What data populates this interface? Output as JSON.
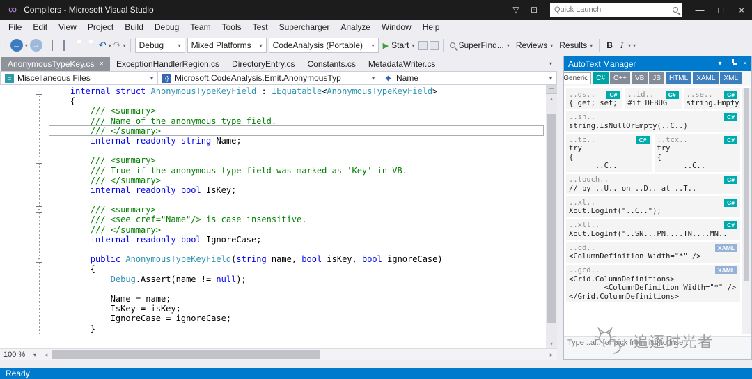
{
  "window": {
    "title": "Compilers - Microsoft Visual Studio"
  },
  "quick_launch": {
    "placeholder": "Quick Launch"
  },
  "icons": {
    "logo": "∞",
    "filter": "▽",
    "feedback": "⊡",
    "minimize": "—",
    "maximize": "□",
    "close": "×",
    "back": "←",
    "forward": "→",
    "undo": "↶",
    "redo": "↷",
    "caret": "▾",
    "play": "▶",
    "fold": "-",
    "split": "—",
    "scroll_up": "▴",
    "scroll_down": "▾",
    "scroll_left": "◂",
    "scroll_right": "▸"
  },
  "menu": {
    "items": [
      "File",
      "Edit",
      "View",
      "Project",
      "Build",
      "Debug",
      "Team",
      "Tools",
      "Test",
      "Supercharger",
      "Analyze",
      "Window",
      "Help"
    ]
  },
  "toolbar": {
    "solution_config": "Debug",
    "platform": "Mixed Platforms",
    "run_config": "CodeAnalysis (Portable)",
    "start": "Start",
    "superfind": "SuperFind...",
    "reviews": "Reviews",
    "results": "Results",
    "bold": "B",
    "italic": "I"
  },
  "doc_tabs": [
    {
      "label": "AnonymousTypeKey.cs",
      "active": true
    },
    {
      "label": "ExceptionHandlerRegion.cs",
      "active": false
    },
    {
      "label": "DirectoryEntry.cs",
      "active": false
    },
    {
      "label": "Constants.cs",
      "active": false
    },
    {
      "label": "MetadataWriter.cs",
      "active": false
    }
  ],
  "breadcrumb": {
    "project": "Miscellaneous Files",
    "type": "Microsoft.CodeAnalysis.Emit.AnonymousTyp",
    "member": "Name"
  },
  "editor": {
    "zoom": "100 %",
    "lines": [
      {
        "fold": true,
        "tokens": [
          [
            "p",
            "    "
          ],
          [
            "k",
            "internal"
          ],
          [
            "p",
            " "
          ],
          [
            "k",
            "struct"
          ],
          [
            "p",
            " "
          ],
          [
            "t",
            "AnonymousTypeKeyField"
          ],
          [
            "p",
            " : "
          ],
          [
            "t",
            "IEquatable"
          ],
          [
            "p",
            "<"
          ],
          [
            "t",
            "AnonymousTypeKeyField"
          ],
          [
            "p",
            ">"
          ]
        ]
      },
      {
        "tokens": [
          [
            "p",
            "    {"
          ]
        ]
      },
      {
        "tokens": [
          [
            "p",
            "        "
          ],
          [
            "c",
            "/// <summary>"
          ]
        ]
      },
      {
        "tokens": [
          [
            "p",
            "        "
          ],
          [
            "c",
            "/// Name of the anonymous type field."
          ]
        ]
      },
      {
        "hl": true,
        "tokens": [
          [
            "p",
            "        "
          ],
          [
            "c",
            "/// </summary>"
          ]
        ]
      },
      {
        "tokens": [
          [
            "p",
            "        "
          ],
          [
            "k",
            "internal"
          ],
          [
            "p",
            " "
          ],
          [
            "k",
            "readonly"
          ],
          [
            "p",
            " "
          ],
          [
            "k",
            "string"
          ],
          [
            "p",
            " Name;"
          ]
        ]
      },
      {
        "tokens": []
      },
      {
        "fold": true,
        "tokens": [
          [
            "p",
            "        "
          ],
          [
            "c",
            "/// <summary>"
          ]
        ]
      },
      {
        "tokens": [
          [
            "p",
            "        "
          ],
          [
            "c",
            "/// True if the anonymous type field was marked as 'Key' in VB."
          ]
        ]
      },
      {
        "tokens": [
          [
            "p",
            "        "
          ],
          [
            "c",
            "/// </summary>"
          ]
        ]
      },
      {
        "tokens": [
          [
            "p",
            "        "
          ],
          [
            "k",
            "internal"
          ],
          [
            "p",
            " "
          ],
          [
            "k",
            "readonly"
          ],
          [
            "p",
            " "
          ],
          [
            "k",
            "bool"
          ],
          [
            "p",
            " IsKey;"
          ]
        ]
      },
      {
        "tokens": []
      },
      {
        "fold": true,
        "tokens": [
          [
            "p",
            "        "
          ],
          [
            "c",
            "/// <summary>"
          ]
        ]
      },
      {
        "tokens": [
          [
            "p",
            "        "
          ],
          [
            "c",
            "/// <see cref=\"Name\"/> is case insensitive."
          ]
        ]
      },
      {
        "tokens": [
          [
            "p",
            "        "
          ],
          [
            "c",
            "/// </summary>"
          ]
        ]
      },
      {
        "tokens": [
          [
            "p",
            "        "
          ],
          [
            "k",
            "internal"
          ],
          [
            "p",
            " "
          ],
          [
            "k",
            "readonly"
          ],
          [
            "p",
            " "
          ],
          [
            "k",
            "bool"
          ],
          [
            "p",
            " IgnoreCase;"
          ]
        ]
      },
      {
        "tokens": []
      },
      {
        "fold": true,
        "tokens": [
          [
            "p",
            "        "
          ],
          [
            "k",
            "public"
          ],
          [
            "p",
            " "
          ],
          [
            "t",
            "AnonymousTypeKeyField"
          ],
          [
            "p",
            "("
          ],
          [
            "k",
            "string"
          ],
          [
            "p",
            " name, "
          ],
          [
            "k",
            "bool"
          ],
          [
            "p",
            " isKey, "
          ],
          [
            "k",
            "bool"
          ],
          [
            "p",
            " ignoreCase)"
          ]
        ]
      },
      {
        "tokens": [
          [
            "p",
            "        {"
          ]
        ]
      },
      {
        "tokens": [
          [
            "p",
            "            "
          ],
          [
            "t",
            "Debug"
          ],
          [
            "p",
            ".Assert(name != "
          ],
          [
            "k",
            "null"
          ],
          [
            "p",
            ");"
          ]
        ]
      },
      {
        "tokens": []
      },
      {
        "tokens": [
          [
            "p",
            "            Name = name;"
          ]
        ]
      },
      {
        "tokens": [
          [
            "p",
            "            IsKey = isKey;"
          ]
        ]
      },
      {
        "tokens": [
          [
            "p",
            "            IgnoreCase = ignoreCase;"
          ]
        ]
      },
      {
        "tokens": [
          [
            "p",
            "        }"
          ]
        ]
      }
    ]
  },
  "panel": {
    "title": "AutoText Manager",
    "lang_tabs": [
      {
        "label": "Generic",
        "style": "plain"
      },
      {
        "label": "C#",
        "style": "teal"
      },
      {
        "label": "C++",
        "style": "gray"
      },
      {
        "label": "VB",
        "style": "gray"
      },
      {
        "label": "JS",
        "style": "gray"
      },
      {
        "label": "HTML",
        "style": "blue"
      },
      {
        "label": "XAML",
        "style": "blue"
      },
      {
        "label": "XML",
        "style": "blue"
      }
    ],
    "rows": [
      [
        {
          "name": "..gs..",
          "lang": "C#",
          "body": [
            "{ get; set; }"
          ]
        },
        {
          "name": "..id..",
          "lang": "C#",
          "body": [
            "#if DEBUG"
          ]
        },
        {
          "name": "..se..",
          "lang": "C#",
          "body": [
            "string.Empty"
          ]
        }
      ],
      [
        {
          "name": "..sn..",
          "lang": "C#",
          "body": [
            "string.IsNullOrEmpty(..C..)"
          ]
        }
      ],
      [
        {
          "name": "..tc..",
          "lang": "C#",
          "body": [
            "try",
            "{",
            "      ..C.."
          ]
        },
        {
          "name": "..tcx..",
          "lang": "C#",
          "body": [
            "try",
            "{",
            "      ..C.."
          ]
        }
      ],
      [
        {
          "name": "..touch..",
          "lang": "C#",
          "body": [
            "// by ..U.. on ..D.. at ..T.."
          ]
        }
      ],
      [
        {
          "name": "..xl..",
          "lang": "C#",
          "body": [
            "Xout.LogInf(\"..C..\");"
          ]
        }
      ],
      [
        {
          "name": "..xll..",
          "lang": "C#",
          "body": [
            "Xout.LogInf(\"..SN...PN....TN....MN.."
          ]
        }
      ],
      [
        {
          "name": "..cd..",
          "lang": "XAML",
          "body": [
            "<ColumnDefinition Width=\"*\" />"
          ]
        }
      ],
      [
        {
          "name": "..gcd..",
          "lang": "XAML",
          "body": [
            "<Grid.ColumnDefinitions>",
            "        <ColumnDefinition Width=\"*\" />",
            "</Grid.ColumnDefinitions>"
          ]
        }
      ]
    ],
    "hint": "Type ..al.. [or pick from list] to insert"
  },
  "status": {
    "text": "Ready"
  },
  "watermark": {
    "text": "追逐时光者"
  }
}
